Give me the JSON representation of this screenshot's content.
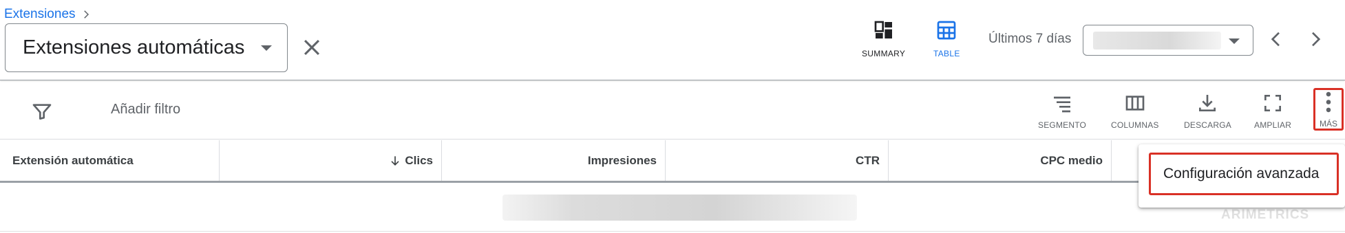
{
  "breadcrumb": {
    "parent": "Extensiones"
  },
  "picker": {
    "value": "Extensiones automáticas"
  },
  "views": {
    "summary_label": "SUMMARY",
    "table_label": "TABLE"
  },
  "date": {
    "label": "Últimos 7 días"
  },
  "toolbar": {
    "add_filter": "Añadir filtro",
    "segment": "SEGMENTO",
    "columns": "COLUMNAS",
    "download": "DESCARGA",
    "expand": "AMPLIAR",
    "more": "MÁS"
  },
  "table": {
    "columns": [
      "Extensión automática",
      "Clics",
      "Impresiones",
      "CTR",
      "CPC medio"
    ]
  },
  "menu": {
    "advanced_settings": "Configuración avanzada"
  },
  "watermark": "ARIMETRICS",
  "colors": {
    "accent": "#1a73e8",
    "highlight": "#d93025",
    "icon": "#5f6368"
  }
}
